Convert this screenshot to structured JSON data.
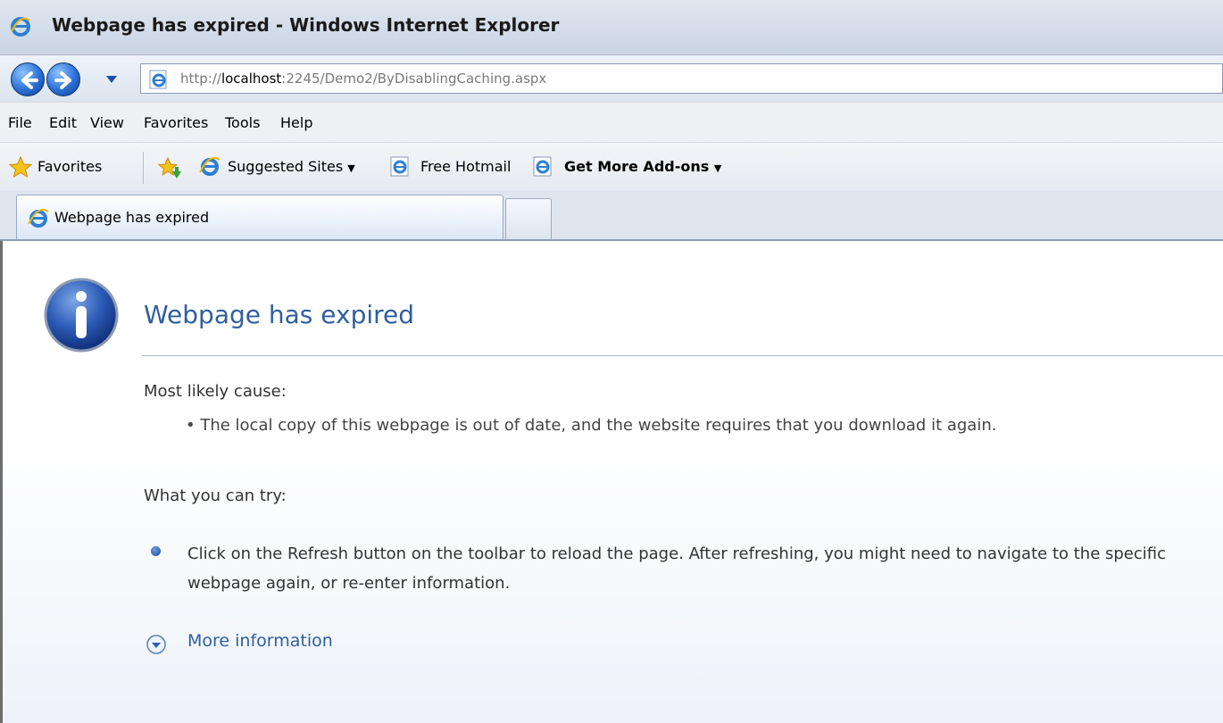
{
  "window": {
    "title": "Webpage has expired - Windows Internet Explorer"
  },
  "nav": {
    "address_prefix": "http://",
    "address_host": "localhost",
    "address_path": ":2245/Demo2/ByDisablingCaching.aspx"
  },
  "menu": {
    "items": [
      "File",
      "Edit",
      "View",
      "Favorites",
      "Tools",
      "Help"
    ]
  },
  "favorites_bar": {
    "favorites_label": "Favorites",
    "suggested_sites_label": "Suggested Sites",
    "free_hotmail_label": "Free Hotmail",
    "get_addons_label": "Get More Add-ons"
  },
  "tab": {
    "label": "Webpage has expired"
  },
  "page": {
    "heading": "Webpage has expired",
    "cause_label": "Most likely cause:",
    "cause_bullet": "• The local copy of this webpage is out of date, and the website requires that you download it again.",
    "try_label": "What you can try:",
    "try_text": "Click on the Refresh button on the toolbar to reload the page. After refreshing, you might need to navigate to the specific webpage again, or re-enter information.",
    "more_info": "More information"
  },
  "icons": {
    "app": "internet-explorer-icon",
    "back": "back-arrow-icon",
    "forward": "forward-arrow-icon",
    "info": "info-icon",
    "expand": "chevron-down-circle-icon"
  },
  "colors": {
    "heading": "#2f5f9e",
    "link": "#2f5f9e",
    "accent": "#2a6fd6"
  }
}
